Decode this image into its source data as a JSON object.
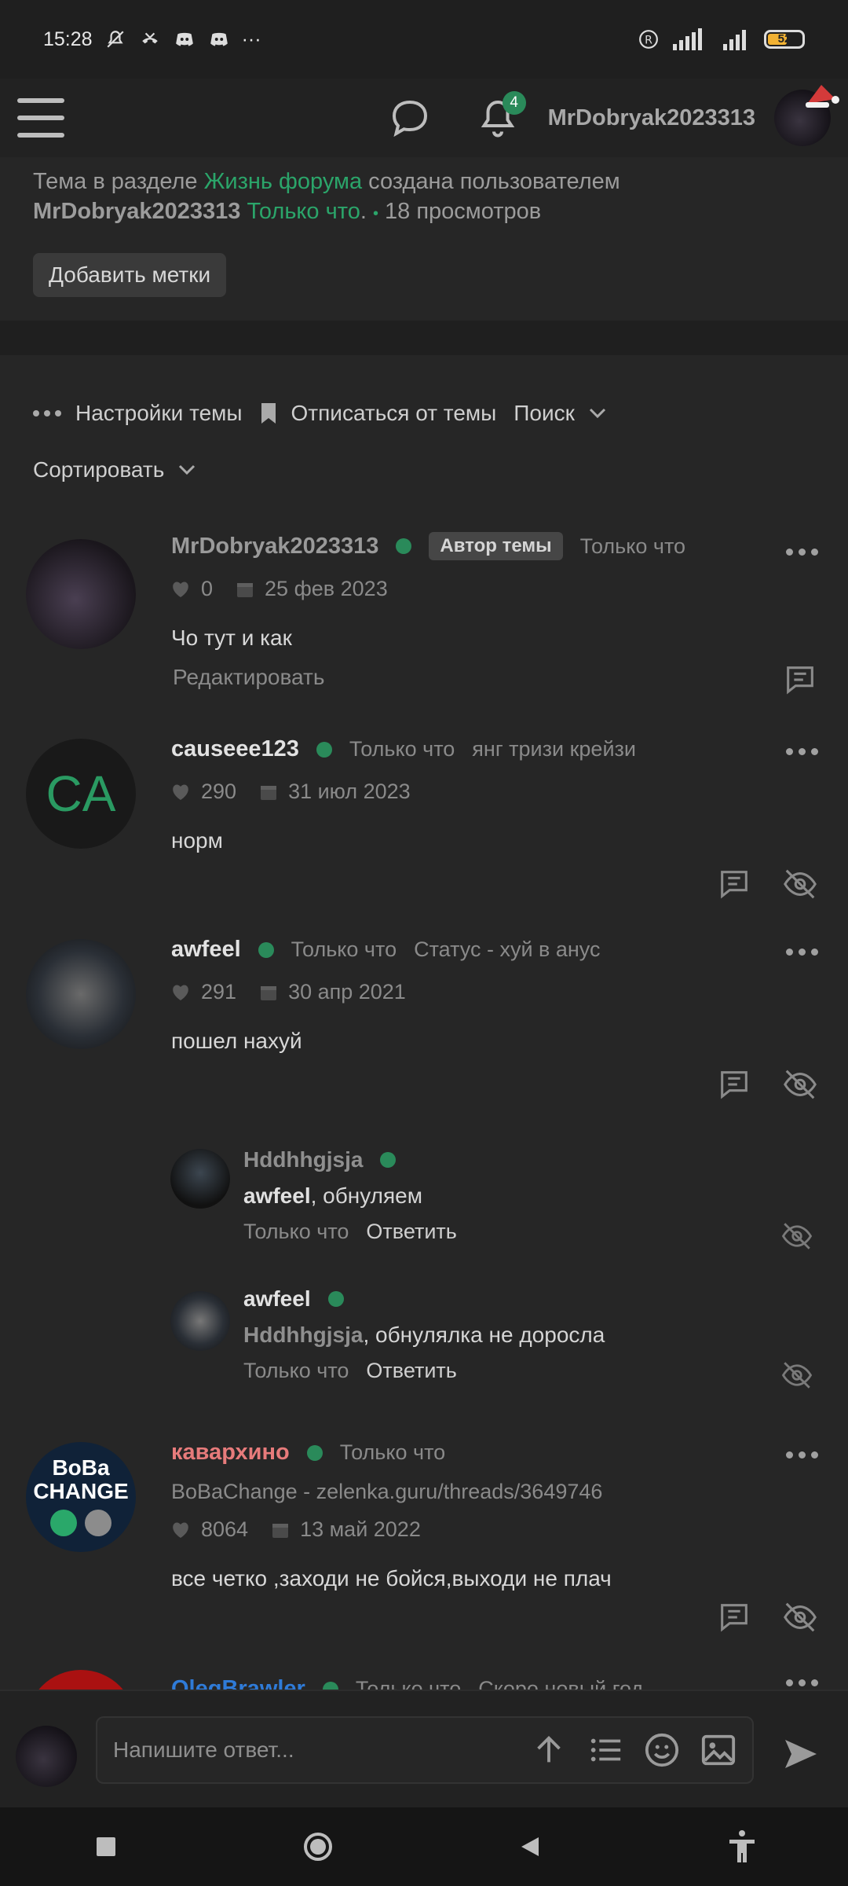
{
  "status_bar": {
    "time": "15:28",
    "more": "···",
    "battery": "52"
  },
  "nav": {
    "username": "MrDobryak2023313",
    "notif_count": "4"
  },
  "thread": {
    "meta_prefix": "Тема в разделе",
    "section": "Жизнь форума",
    "meta_mid": "создана пользователем",
    "author": "MrDobryak2023313",
    "time": "Только что",
    "views_dot": "•",
    "views": "18 просмотров",
    "add_tags": "Добавить метки"
  },
  "actions": {
    "settings": "Настройки темы",
    "unsubscribe": "Отписаться от темы",
    "search": "Поиск",
    "sort": "Сортировать"
  },
  "posts": [
    {
      "name": "MrDobryak2023313",
      "badge": "Автор темы",
      "time": "Только что",
      "likes": "0",
      "date": "25 фев 2023",
      "text": "Чо тут и как",
      "edit": "Редактировать"
    },
    {
      "name": "causeee123",
      "avatar_text": "CA",
      "time": "Только что",
      "status": "янг тризи крейзи",
      "likes": "290",
      "date": "31 июл 2023",
      "text": "норм"
    },
    {
      "name": "awfeel",
      "time": "Только что",
      "status": "Статус - хуй в анус",
      "likes": "291",
      "date": "30 апр 2021",
      "text": "пошел нахуй"
    },
    {
      "name": "кавархино",
      "time": "Только что",
      "status": "BoBaChange - zelenka.guru/threads/3649746",
      "likes": "8064",
      "date": "13 май 2022",
      "text": "все четко ,заходи не бойся,выходи не плач",
      "avatar_line1": "BoBa",
      "avatar_line2": "CHANGE"
    },
    {
      "name": "OlegBrawler",
      "time": "Только что",
      "status": "Скоро новый год"
    }
  ],
  "replies": [
    {
      "name": "Hddhhgjsja",
      "mention": "awfeel",
      "text": ", обнуляем",
      "time": "Только что",
      "reply": "Ответить"
    },
    {
      "name": "awfeel",
      "mention": "Hddhhgjsja",
      "text": ", обнулялка не доросла",
      "time": "Только что",
      "reply": "Ответить"
    }
  ],
  "composer": {
    "placeholder": "Напишите ответ..."
  }
}
